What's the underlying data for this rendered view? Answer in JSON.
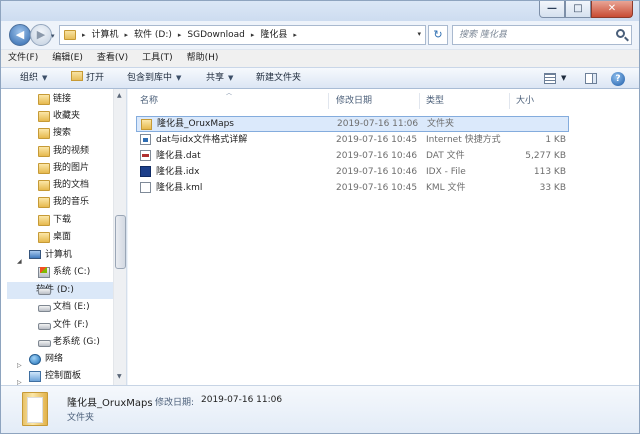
{
  "window": {
    "controls": {
      "minimize": "—",
      "maximize": "□",
      "close": "✕"
    }
  },
  "address": {
    "nav_dropdown": "▾",
    "breadcrumbs": [
      "计算机",
      "软件 (D:)",
      "SGDownload",
      "隆化县"
    ],
    "separator": "▸",
    "dropdown": "▾",
    "refresh": "↻"
  },
  "search": {
    "placeholder": "搜索 隆化县"
  },
  "menubar": [
    "文件(F)",
    "编辑(E)",
    "查看(V)",
    "工具(T)",
    "帮助(H)"
  ],
  "commands": {
    "organize": "组织",
    "open": "打开",
    "include_in_library": "包含到库中",
    "share": "共享",
    "new_folder": "新建文件夹",
    "help": "?"
  },
  "nav": {
    "favorites": [
      "链接",
      "收藏夹",
      "搜索",
      "我的视频",
      "我的图片",
      "我的文档",
      "我的音乐",
      "下载",
      "桌面"
    ],
    "computer": "计算机",
    "drives": [
      "系统 (C:)",
      "软件 (D:)",
      "文档 (E:)",
      "文件 (F:)",
      "老系统 (G:)"
    ],
    "network": "网络",
    "control_panel": "控制面板"
  },
  "columns": {
    "name": "名称",
    "date": "修改日期",
    "type": "类型",
    "size": "大小"
  },
  "files": [
    {
      "name": "隆化县_OruxMaps",
      "date": "2019-07-16 11:06",
      "type": "文件夹",
      "size": "",
      "icon": "folder-icon"
    },
    {
      "name": "dat与idx文件格式详解",
      "date": "2019-07-16 10:45",
      "type": "Internet 快捷方式",
      "size": "1 KB",
      "icon": "url-icon"
    },
    {
      "name": "隆化县.dat",
      "date": "2019-07-16 10:46",
      "type": "DAT 文件",
      "size": "5,277 KB",
      "icon": "dat-icon"
    },
    {
      "name": "隆化县.idx",
      "date": "2019-07-16 10:46",
      "type": "IDX - File",
      "size": "113 KB",
      "icon": "idx-icon"
    },
    {
      "name": "隆化县.kml",
      "date": "2019-07-16 10:45",
      "type": "KML 文件",
      "size": "33 KB",
      "icon": "kml-icon"
    }
  ],
  "details": {
    "name": "隆化县_OruxMaps",
    "modified_label": "修改日期:",
    "modified_value": "2019-07-16 11:06",
    "type": "文件夹"
  }
}
